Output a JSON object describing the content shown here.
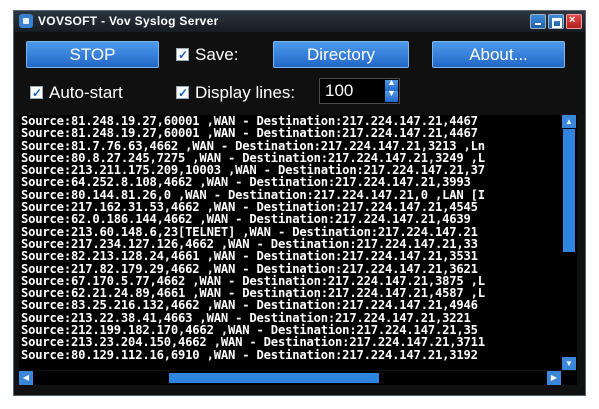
{
  "window": {
    "title": "VOVSOFT - Vov Syslog Server",
    "minimize_icon": "minimize-icon",
    "maximize_icon": "maximize-icon",
    "close_icon": "close-icon"
  },
  "toolbar": {
    "stop_label": "STOP",
    "save_label": "Save:",
    "save_checked": true,
    "directory_label": "Directory",
    "about_label": "About...",
    "autostart_label": "Auto-start",
    "autostart_checked": true,
    "display_lines_label": "Display lines:",
    "display_lines_checked": true,
    "display_lines_value": "100"
  },
  "colors": {
    "accent": "#2f84e0",
    "background": "#101010",
    "text": "#ffffff"
  },
  "log_lines": [
    "Source:81.248.19.27,60001 ,WAN - Destination:217.224.147.21,4467",
    "Source:81.248.19.27,60001 ,WAN - Destination:217.224.147.21,4467",
    "Source:81.7.76.63,4662 ,WAN - Destination:217.224.147.21,3213 ,Ln",
    "Source:80.8.27.245,7275 ,WAN - Destination:217.224.147.21,3249 ,L",
    "Source:213.211.175.209,10003 ,WAN - Destination:217.224.147.21,37",
    "Source:64.252.8.108,4662 ,WAN - Destination:217.224.147.21,3993",
    "Source:80.144.81.26,0 ,WAN - Destination:217.224.147.21,0 ,LAN [I",
    "Source:217.162.31.53,4662 ,WAN - Destination:217.224.147.21,4545",
    "Source:62.0.186.144,4662 ,WAN - Destination:217.224.147.21,4639",
    "Source:213.60.148.6,23[TELNET] ,WAN - Destination:217.224.147.21",
    "Source:217.234.127.126,4662 ,WAN - Destination:217.224.147.21,33",
    "Source:82.213.128.24,4661 ,WAN - Destination:217.224.147.21,3531",
    "Source:217.82.179.29,4662 ,WAN - Destination:217.224.147.21,3621",
    "Source:67.170.5.77,4662 ,WAN - Destination:217.224.147.21,3875 ,L",
    "Source:62.21.24.89,4661 ,WAN - Destination:217.224.147.21,4587 ,L",
    "Source:83.25.216.132,4662 ,WAN - Destination:217.224.147.21,4946",
    "Source:213.22.38.41,4663 ,WAN - Destination:217.224.147.21,3221",
    "Source:212.199.182.170,4662 ,WAN - Destination:217.224.147.21,35",
    "Source:213.23.204.150,4662 ,WAN - Destination:217.224.147.21,3711",
    "Source:80.129.112.16,6910 ,WAN - Destination:217.224.147.21,3192"
  ]
}
